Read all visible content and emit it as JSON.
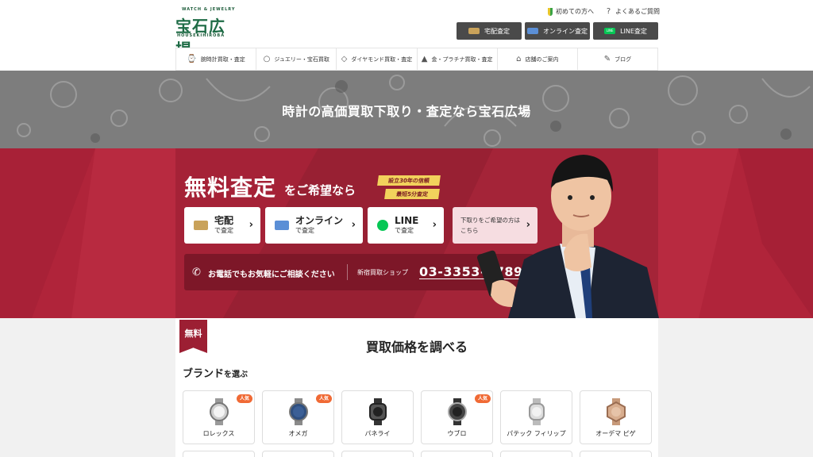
{
  "header": {
    "logo_top": "WATCH & JEWELRY",
    "logo_main": "宝石広場",
    "logo_sub": "HOUSEKIHIROBA",
    "link_beginner": "初めての方へ",
    "link_faq": "よくあるご質問",
    "btn_takuhai": "宅配査定",
    "btn_online": "オンライン査定",
    "btn_line": "LINE査定",
    "btn_line_badge": "LINE"
  },
  "nav": [
    {
      "label": "腕時計買取・査定",
      "icon": "watch-icon"
    },
    {
      "label": "ジュエリー・宝石買取",
      "icon": "ring-icon"
    },
    {
      "label": "ダイヤモンド買取・査定",
      "icon": "diamond-icon"
    },
    {
      "label": "金・プラチナ買取・査定",
      "icon": "gold-icon"
    },
    {
      "label": "店舗のご案内",
      "icon": "store-icon"
    },
    {
      "label": "ブログ",
      "icon": "blog-icon"
    }
  ],
  "hero": {
    "title": "時計の高価買取下取り・査定なら宝石広場"
  },
  "assess": {
    "headline": "無料査定",
    "headline_sub": "をご希望なら",
    "badge1": "設立30年の信頼",
    "badge2": "最短5分査定",
    "cards": [
      {
        "title": "宅配",
        "sub": "で査定"
      },
      {
        "title": "オンライン",
        "sub": "で査定"
      },
      {
        "title": "LINE",
        "sub": "で査定"
      }
    ],
    "trade_in_line1": "下取りをご希望の方は",
    "trade_in_line2": "こちら",
    "phone_text": "お電話でもお気軽にご相談ください",
    "shop": "新宿買取ショップ",
    "phone": "03-3353-7789"
  },
  "lower": {
    "free_tag": "無料",
    "title": "買取価格を調べる",
    "brand_heading": "ブランド",
    "brand_heading_sub": "を選ぶ",
    "popular_badge": "人気",
    "brands": [
      {
        "name": "ロレックス",
        "popular": true
      },
      {
        "name": "オメガ",
        "popular": true
      },
      {
        "name": "パネライ",
        "popular": false
      },
      {
        "name": "ウブロ",
        "popular": true
      },
      {
        "name": "パテック フィリップ",
        "popular": false
      },
      {
        "name": "オーデマ ピゲ",
        "popular": false
      }
    ]
  },
  "colors": {
    "brand_green": "#1d6b45",
    "band_red": "#b0243a",
    "panel_red": "#9c1f33",
    "gold_ribbon": "#f2d25c",
    "popular_orange": "#f06a35",
    "line_green": "#06c755"
  }
}
